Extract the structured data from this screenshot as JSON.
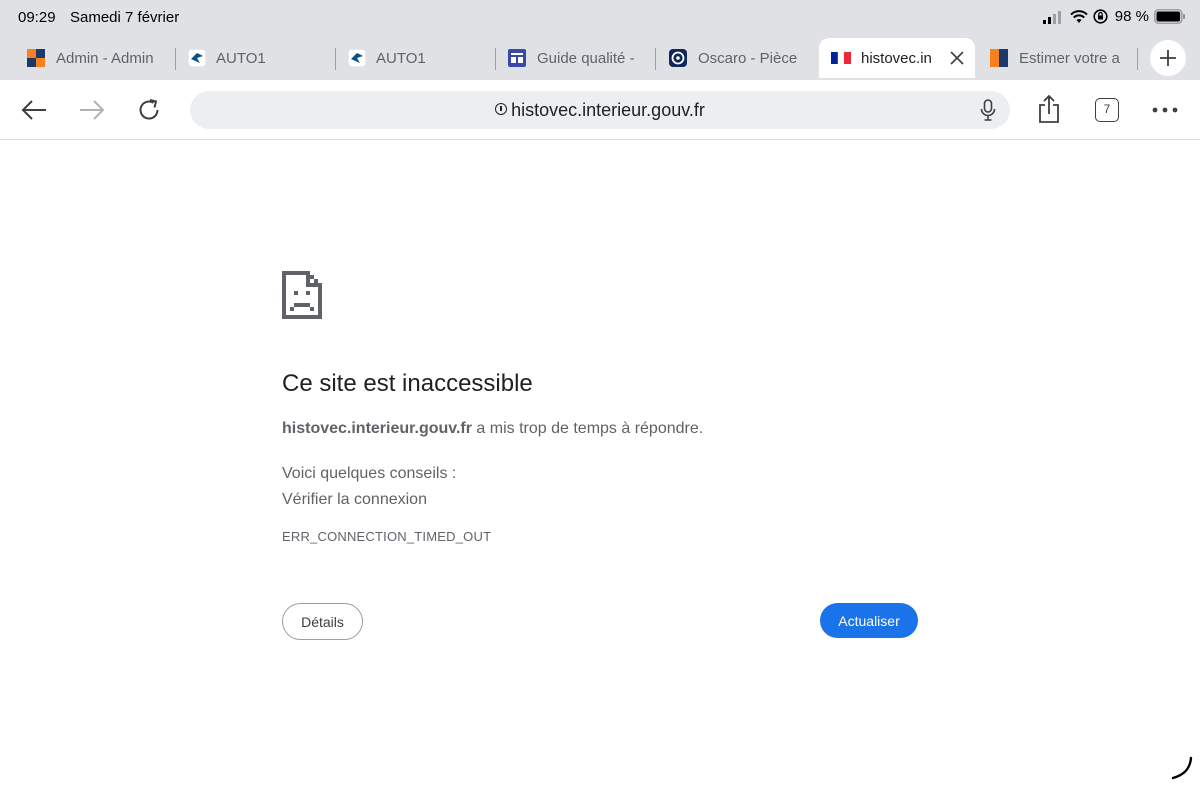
{
  "status_bar": {
    "time": "09:29",
    "date": "Samedi 7 février",
    "battery": "98 %"
  },
  "tabs": [
    {
      "title": "Admin - Admin",
      "favicon": "admin-favicon-icon",
      "active": false
    },
    {
      "title": "AUTO1",
      "favicon": "auto1-favicon-icon",
      "active": false
    },
    {
      "title": "AUTO1",
      "favicon": "auto1-favicon-icon",
      "active": false
    },
    {
      "title": "Guide qualité -",
      "favicon": "guide-favicon-icon",
      "active": false
    },
    {
      "title": "Oscaro - Pièce",
      "favicon": "oscaro-favicon-icon",
      "active": false
    },
    {
      "title": "histovec.in",
      "favicon": "french-flag-icon",
      "active": true
    },
    {
      "title": "Estimer votre a",
      "favicon": "estimer-favicon-icon",
      "active": false
    }
  ],
  "toolbar": {
    "url": "histovec.interieur.gouv.fr",
    "tab_count": "7"
  },
  "error": {
    "title": "Ce site est inaccessible",
    "host": "histovec.interieur.gouv.fr",
    "message_rest": " a mis trop de temps à répondre.",
    "tips_heading": "Voici quelques conseils :",
    "tip_1": "Vérifier la connexion",
    "code": "ERR_CONNECTION_TIMED_OUT",
    "details_label": "Détails",
    "reload_label": "Actualiser"
  },
  "colors": {
    "chrome_bg": "#dfe1e5",
    "accent": "#1a73e8",
    "text_secondary": "#5f6368"
  }
}
